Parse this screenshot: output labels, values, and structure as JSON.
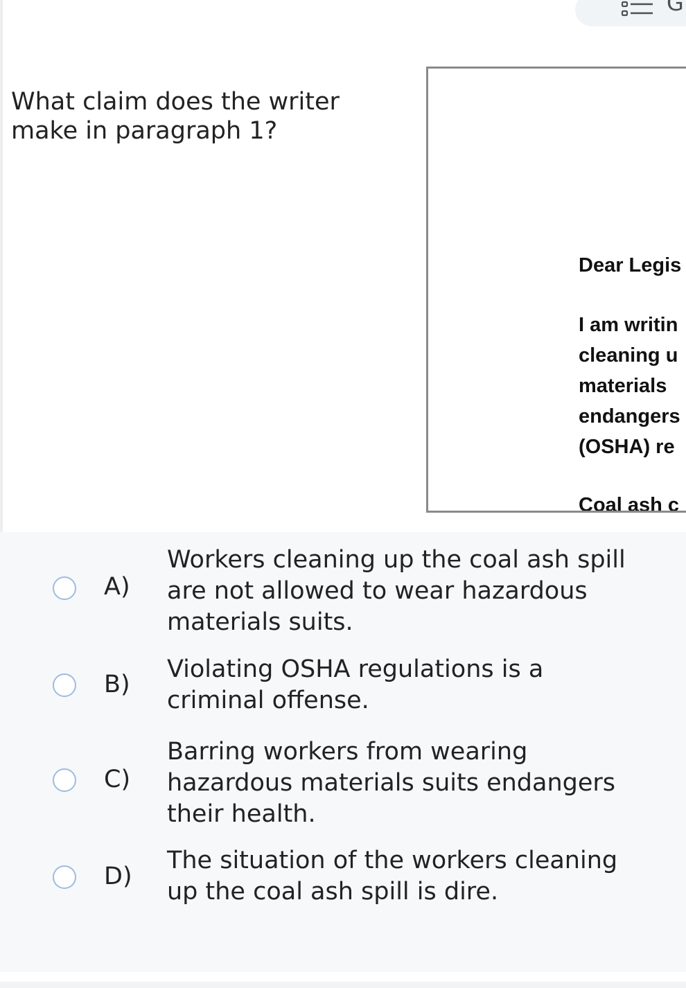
{
  "toolbar": {
    "icon": "list-icon",
    "truncated_label": "G"
  },
  "question": {
    "line1": "What claim does the writer",
    "line2": "make in paragraph 1?"
  },
  "passage": {
    "salutation": "Dear Legis",
    "paragraph1_lines": [
      "I am writin",
      "cleaning u",
      "materials",
      "endangers",
      "(OSHA) re"
    ],
    "paragraph2_start": "Coal ash c"
  },
  "options": [
    {
      "letter": "A)",
      "lines": [
        "Workers cleaning up the coal ash spill",
        "are not allowed to wear hazardous",
        "materials suits."
      ]
    },
    {
      "letter": "B)",
      "lines": [
        "Violating OSHA regulations is a",
        "criminal offense."
      ]
    },
    {
      "letter": "C)",
      "lines": [
        "Barring workers from wearing",
        "hazardous materials suits endangers",
        "their health."
      ]
    },
    {
      "letter": "D)",
      "lines": [
        "The situation of the workers cleaning",
        "up the coal ash spill is dire."
      ]
    }
  ],
  "colors": {
    "radio_border": "#9ebbe0",
    "answer_background": "#f7f8fa",
    "scroll_indicator": "#7fb0f5"
  }
}
